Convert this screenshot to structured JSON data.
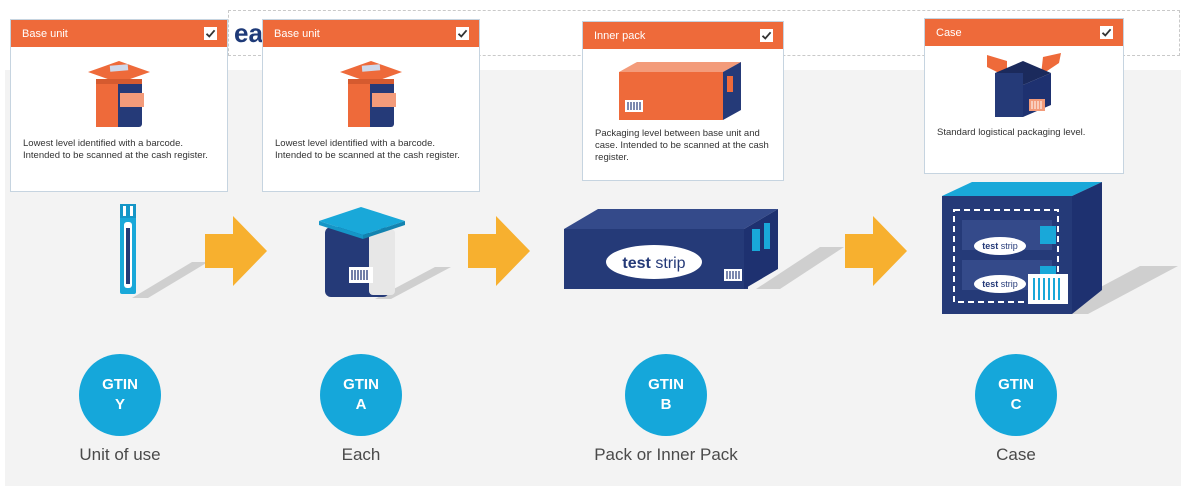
{
  "brand_fragment": "ea",
  "cards": [
    {
      "title": "Base unit",
      "checked": true,
      "description": "Lowest level identified with a barcode. Intended to be scanned at the cash register.",
      "icon": "can-icon"
    },
    {
      "title": "Base unit",
      "checked": true,
      "description": "Lowest level identified with a barcode. Intended to be scanned at the cash register.",
      "icon": "can-icon"
    },
    {
      "title": "Inner pack",
      "checked": true,
      "description": "Packaging level between base unit and case. Intended to be scanned at the cash register.",
      "icon": "box-icon"
    },
    {
      "title": "Case",
      "checked": true,
      "description": "Standard logistical packaging level.",
      "icon": "open-case-icon"
    }
  ],
  "products": [
    {
      "name": "test-strip-icon",
      "label": ""
    },
    {
      "name": "vial-icon",
      "label": ""
    },
    {
      "name": "pack-icon",
      "label_bold": "test",
      "label_light": "strip"
    },
    {
      "name": "case-icon",
      "label_bold": "test",
      "label_light": "strip"
    }
  ],
  "levels": [
    {
      "gtin_title": "GTIN",
      "gtin_code": "Y",
      "label": "Unit of use"
    },
    {
      "gtin_title": "GTIN",
      "gtin_code": "A",
      "label": "Each"
    },
    {
      "gtin_title": "GTIN",
      "gtin_code": "B",
      "label": "Pack or Inner Pack"
    },
    {
      "gtin_title": "GTIN",
      "gtin_code": "C",
      "label": "Case"
    }
  ],
  "colors": {
    "card_header": "#ee6a3a",
    "gtin_circle": "#15a7da",
    "arrow": "#f7b02f",
    "navy": "#253a78",
    "cyan": "#19a8d9"
  }
}
